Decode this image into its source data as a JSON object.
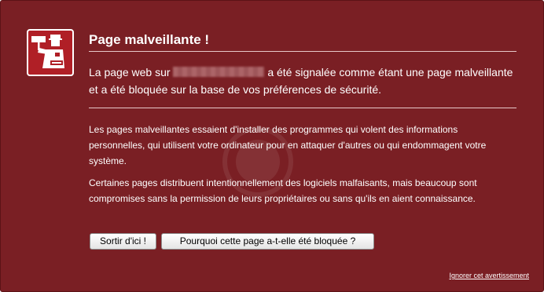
{
  "warning": {
    "title": "Page malveillante !",
    "subtitle_before": "La page web sur",
    "subtitle_after": "a été signalée comme étant une page malveillante et a été bloquée sur la base de vos préférences de sécurité.",
    "paragraph_1": "Les pages malveillantes essaient d'installer des programmes qui volent des informations personnelles, qui utilisent votre ordinateur pour en attaquer d'autres ou qui endommagent votre système.",
    "paragraph_2": "Certaines pages distribuent intentionnellement des logiciels malfaisants, mais beaucoup sont compromises sans la permission de leurs propriétaires ou sans qu'ils en aient connaissance."
  },
  "buttons": {
    "get_out": "Sortir d'ici !",
    "why_blocked": "Pourquoi cette page a-t-elle été bloquée ?"
  },
  "links": {
    "ignore": "Ignorer cet avertissement"
  },
  "icons": {
    "warning_icon": "police-officer-stop-icon",
    "background_emblem": "shield-emblem-icon"
  },
  "colors": {
    "background": "#7a1f24",
    "icon_background": "#b01f26",
    "text": "#ffffff"
  }
}
